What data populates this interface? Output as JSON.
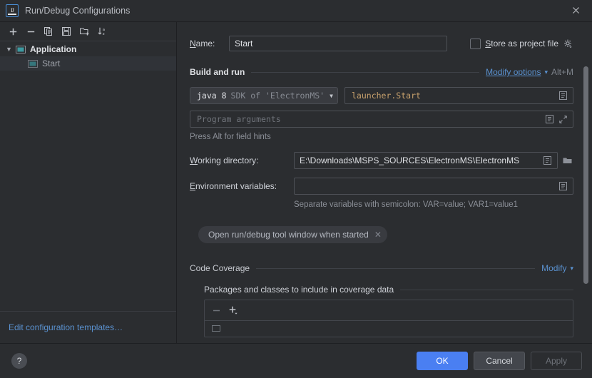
{
  "window": {
    "title": "Run/Debug Configurations",
    "app_icon": "intellij-idea-icon",
    "close_icon": "close-icon"
  },
  "left_panel": {
    "toolbar": [
      {
        "name": "add-configuration-button",
        "icon": "plus-icon",
        "glyph": "+"
      },
      {
        "name": "remove-configuration-button",
        "icon": "minus-icon",
        "glyph": "−"
      },
      {
        "name": "copy-configuration-button",
        "icon": "copy-icon",
        "glyph": "copy"
      },
      {
        "name": "save-configuration-button",
        "icon": "save-icon",
        "glyph": "save"
      },
      {
        "name": "new-folder-button",
        "icon": "folder-add-icon",
        "glyph": "folder"
      },
      {
        "name": "sort-configurations-button",
        "icon": "sort-alphabetical-icon",
        "glyph": "sort"
      }
    ],
    "tree": [
      {
        "label": "Application",
        "type": "group",
        "expanded": true,
        "icon": "application-icon"
      },
      {
        "label": "Start",
        "type": "child",
        "selected": true,
        "icon": "application-icon"
      }
    ],
    "footer_link": "Edit configuration templates…"
  },
  "form": {
    "name_label": "Name:",
    "name_mnemonic": "N",
    "name_value": "Start",
    "store_as_project_file": {
      "label": "Store as project file",
      "mnemonic": "S",
      "checked": false,
      "gear_icon": "gear-icon"
    },
    "build_and_run": {
      "title": "Build and run",
      "modify_options_link": "Modify options",
      "modify_options_shortcut": "Alt+M",
      "chevron": "∨",
      "jdk": {
        "main": "java 8",
        "sub": "SDK of 'ElectronMS'",
        "arrow_icon": "chevron-down-icon"
      },
      "main_class": "launcher.Start",
      "main_class_icons": [
        "insert-macro-icon"
      ],
      "program_arguments_placeholder": "Program arguments",
      "program_arguments_value": "",
      "program_arguments_icons": [
        "insert-macro-icon",
        "expand-icon"
      ],
      "alt_hint": "Press Alt for field hints"
    },
    "working_directory": {
      "label": "Working directory:",
      "mnemonic": "W",
      "value": "E:\\Downloads\\MSPS_SOURCES\\ElectronMS\\ElectronMS",
      "icons": [
        "insert-macro-icon",
        "browse-folder-icon"
      ]
    },
    "environment_variables": {
      "label": "Environment variables:",
      "mnemonic": "E",
      "value": "",
      "icons": [
        "insert-macro-icon"
      ],
      "note": "Separate variables with semicolon: VAR=value; VAR1=value1"
    },
    "option_chip": {
      "label": "Open run/debug tool window when started",
      "remove_icon": "close-icon"
    },
    "code_coverage": {
      "title": "Code Coverage",
      "modify_link": "Modify",
      "chevron": "∨",
      "packages_title": "Packages and classes to include in coverage data",
      "toolbar": [
        {
          "name": "remove-package-button",
          "icon": "minus-icon",
          "glyph": "−",
          "disabled": true
        },
        {
          "name": "add-package-button",
          "icon": "plus-dropdown-icon",
          "glyph": "+",
          "disabled": false
        }
      ]
    }
  },
  "footer": {
    "help_icon": "help-icon",
    "help_glyph": "?",
    "ok": "OK",
    "cancel": "Cancel",
    "apply": "Apply"
  },
  "colors": {
    "background": "#2b2d30",
    "panel": "#393b40",
    "accent_blue": "#4a7ff2",
    "link_blue": "#5a91cf",
    "main_class_text": "#c9a26d",
    "border": "#1e1f22",
    "tree_selected": "#303338"
  }
}
